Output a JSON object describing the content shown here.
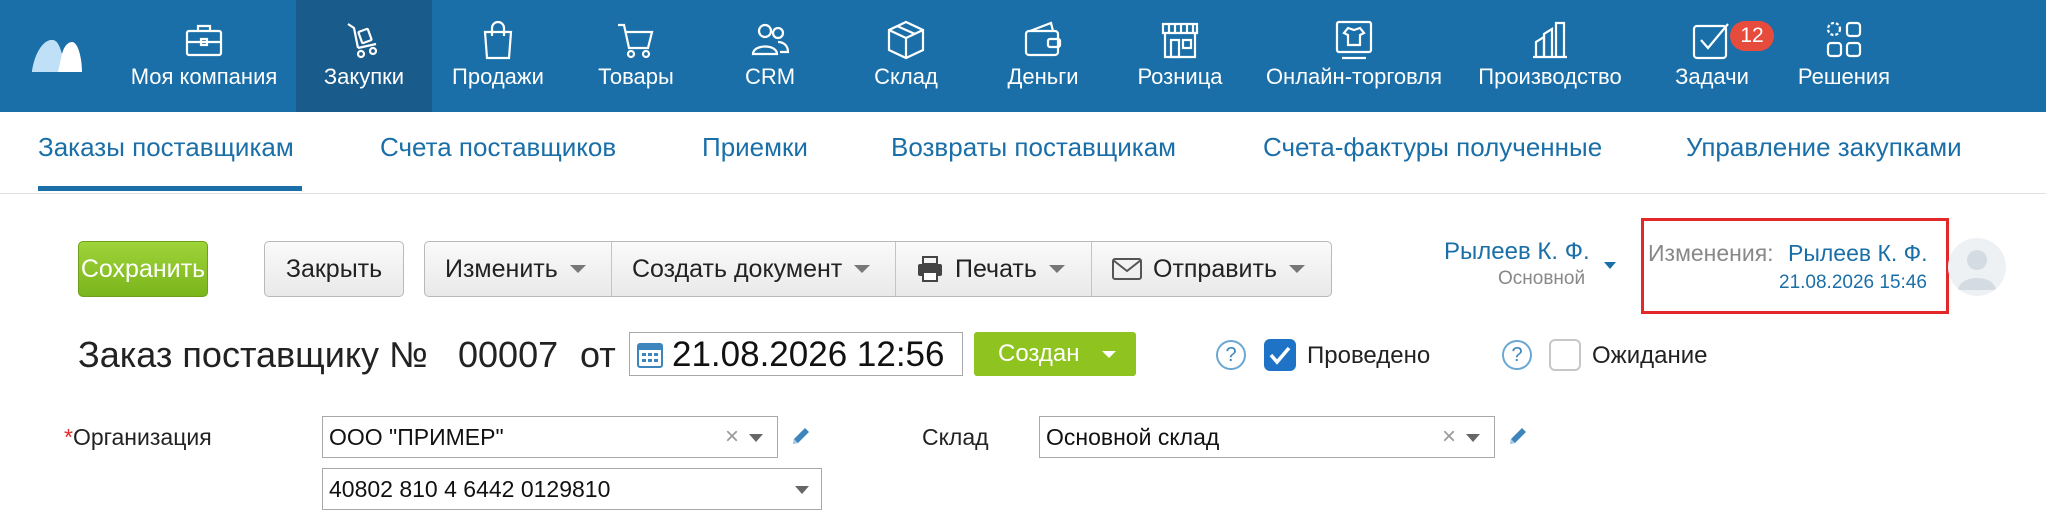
{
  "nav": {
    "items": [
      {
        "label": "Моя компания",
        "icon": "briefcase-icon"
      },
      {
        "label": "Закупки",
        "icon": "cart-hand-icon"
      },
      {
        "label": "Продажи",
        "icon": "shopping-bag-icon"
      },
      {
        "label": "Товары",
        "icon": "cart-icon"
      },
      {
        "label": "CRM",
        "icon": "users-icon"
      },
      {
        "label": "Склад",
        "icon": "box-icon"
      },
      {
        "label": "Деньги",
        "icon": "wallet-icon"
      },
      {
        "label": "Розница",
        "icon": "store-icon"
      },
      {
        "label": "Онлайн-торговля",
        "icon": "tshirt-screen-icon"
      },
      {
        "label": "Производство",
        "icon": "factory-icon"
      },
      {
        "label": "Задачи",
        "icon": "tasks-icon"
      },
      {
        "label": "Решения",
        "icon": "apps-icon"
      }
    ],
    "active": "Закупки",
    "tasks_badge": "12"
  },
  "subnav": {
    "tabs": [
      "Заказы поставщикам",
      "Счета поставщиков",
      "Приемки",
      "Возвраты поставщикам",
      "Счета-фактуры полученные",
      "Управление закупками"
    ],
    "active": "Заказы поставщикам"
  },
  "toolbar": {
    "save": "Сохранить",
    "close": "Закрыть",
    "edit": "Изменить",
    "create_doc": "Создать документ",
    "print": "Печать",
    "send": "Отправить"
  },
  "user": {
    "name": "Рылеев К. Ф.",
    "role": "Основной"
  },
  "changes": {
    "label": "Изменения:",
    "user": "Рылеев К. Ф.",
    "date": "21.08.2026 15:46"
  },
  "document": {
    "title": "Заказ поставщику №",
    "number": "00007",
    "from_label": "от",
    "date": "21.08.2026 12:56",
    "status": "Создан",
    "posted_label": "Проведено",
    "posted": true,
    "waiting_label": "Ожидание",
    "waiting": false,
    "help": "?"
  },
  "form": {
    "org_label": "Организация",
    "org_required_mark": "*",
    "org_value": "ООО \"ПРИМЕР\"",
    "account_value": "40802 810 4 6442 0129810",
    "warehouse_label": "Склад",
    "warehouse_value": "Основной склад",
    "clear_glyph": "×"
  },
  "colors": {
    "nav_bg": "#1a6fa8",
    "nav_active": "#195b8a",
    "save_green": "#8fc31f",
    "link_blue": "#1a6fa8",
    "highlight_red": "#e3282a",
    "badge_red": "#e64b3c"
  }
}
